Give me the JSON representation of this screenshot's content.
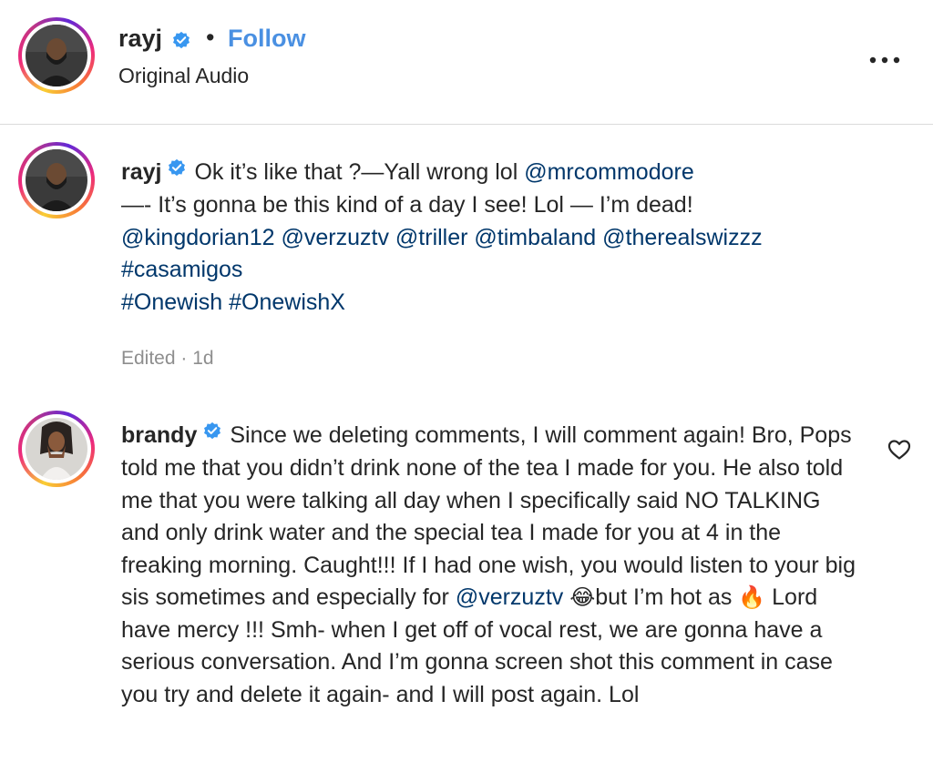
{
  "header": {
    "username": "rayj",
    "separator": "•",
    "follow_label": "Follow",
    "audio_label": "Original Audio"
  },
  "caption": {
    "username": "rayj",
    "text_1": "Ok it’s like that ?—Yall wrong lol ",
    "mention_1": "@mrcommodore",
    "text_2": "—- It’s gonna be this kind of a day I see! Lol — I’m dead!",
    "mention_2": "@kingdorian12",
    "mention_3": "@verzuztv",
    "mention_4": "@triller",
    "mention_5": "@timbaland",
    "mention_6": "@therealswizzz",
    "hashtag_1": "#casamigos",
    "hashtag_2": "#Onewish",
    "hashtag_3": "#OnewishX",
    "meta": "Edited · 1d"
  },
  "comment": {
    "username": "brandy",
    "text_1": "Since we deleting comments, I will comment again! Bro, Pops told me that you didn’t drink none of the tea I made for you. He also told me that you were talking all day when I specifically said NO TALKING and only drink water and the special tea I made for you at 4 in the freaking morning. Caught!!! If I had one wish, you would listen to your big sis sometimes and especially for ",
    "mention_1": "@verzuztv",
    "emoji_1": "😂",
    "text_2": "but I’m hot as ",
    "emoji_2": "🔥",
    "text_3": " Lord have mercy !!! Smh- when I get off of vocal rest, we are gonna have a serious conversation. And I’m gonna screen shot this comment in case you try and delete it again- and I will post again. Lol"
  },
  "icons": {
    "verified": "verified-badge-icon",
    "more": "more-options-icon",
    "heart": "heart-icon"
  },
  "colors": {
    "follow": "#4a90e2",
    "link": "#00376b",
    "verified": "#3897f0",
    "muted": "#8e8e8e"
  }
}
